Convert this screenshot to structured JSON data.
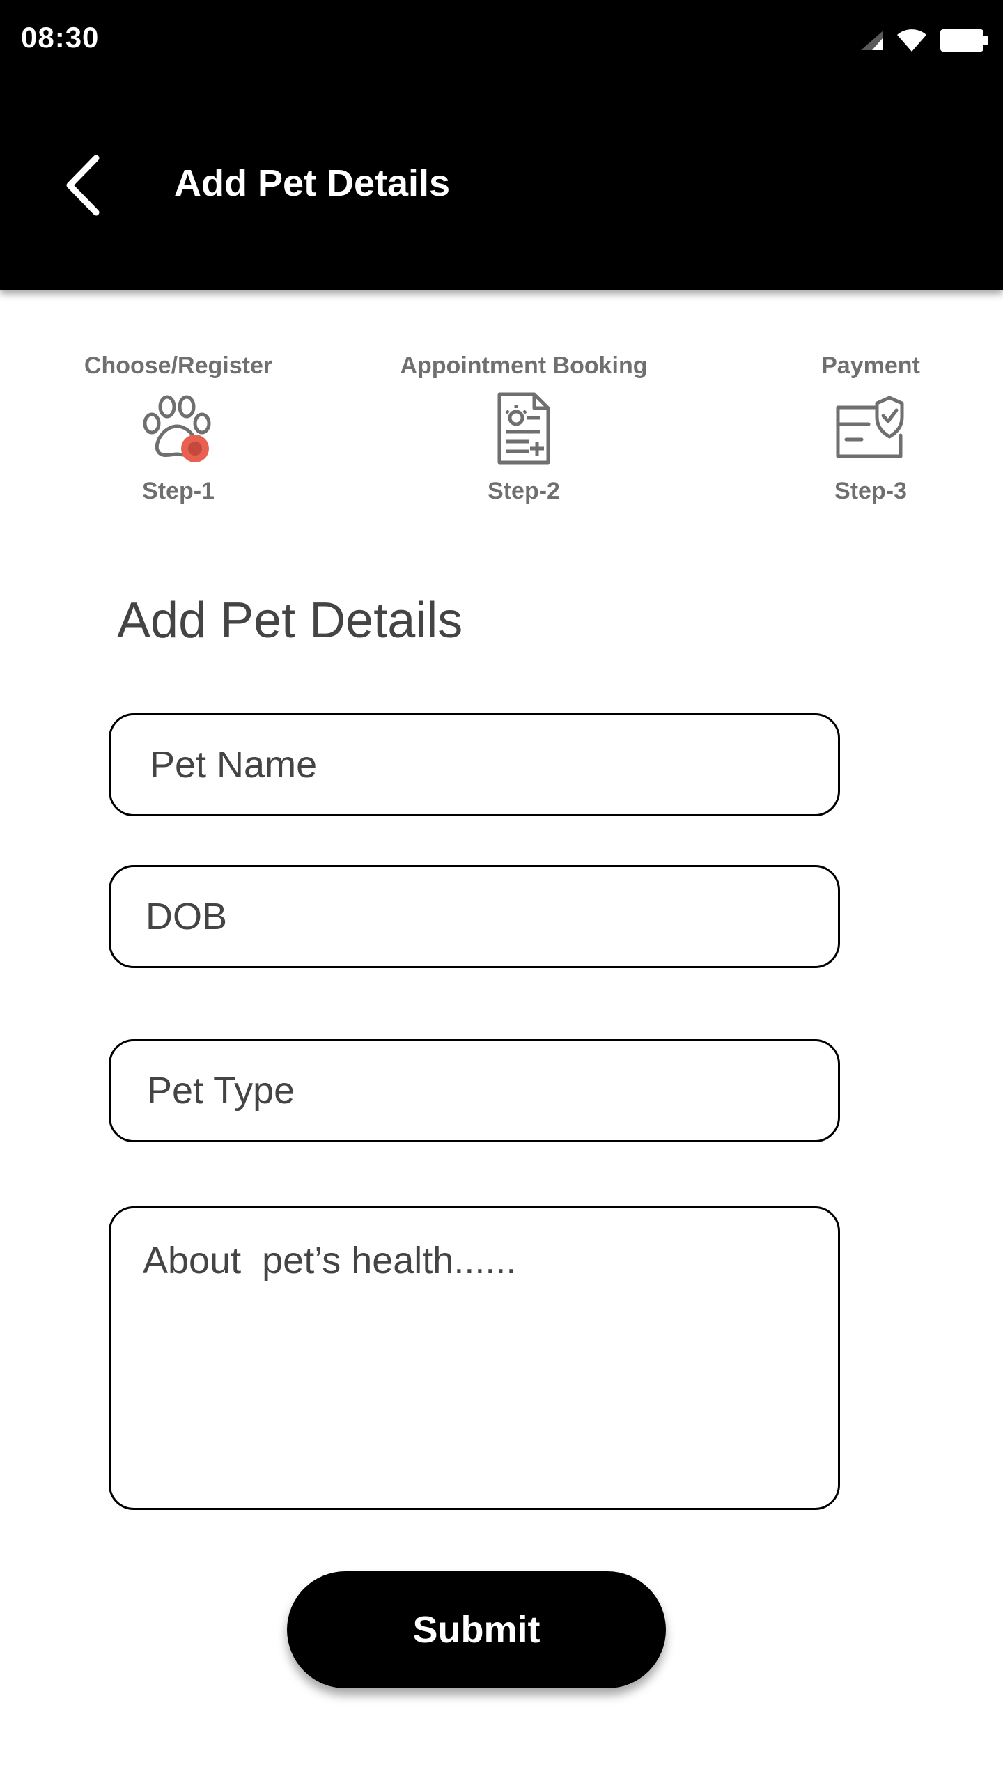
{
  "status_bar": {
    "time": "08:30",
    "icons": [
      "signal-icon",
      "wifi-icon",
      "battery-icon"
    ]
  },
  "app_bar": {
    "back_icon": "chevron-left-icon",
    "title": "Add Pet Details"
  },
  "stepper": {
    "steps": [
      {
        "title": "Choose/Register",
        "label": "Step-1",
        "icon": "paw-icon",
        "active": true
      },
      {
        "title": "Appointment Booking",
        "label": "Step-2",
        "icon": "document-icon",
        "active": false
      },
      {
        "title": "Payment",
        "label": "Step-3",
        "icon": "payment-shield-icon",
        "active": false
      }
    ],
    "active_color": "#e8604f",
    "inactive_color": "#6f6f6f"
  },
  "form": {
    "title": "Add Pet Details",
    "pet_name": {
      "placeholder": "Pet Name",
      "value": ""
    },
    "dob": {
      "placeholder": "DOB",
      "value": ""
    },
    "pet_type": {
      "placeholder": "Pet Type",
      "value": ""
    },
    "health": {
      "placeholder": "About  pet’s health......",
      "value": ""
    },
    "submit_label": "Submit"
  }
}
